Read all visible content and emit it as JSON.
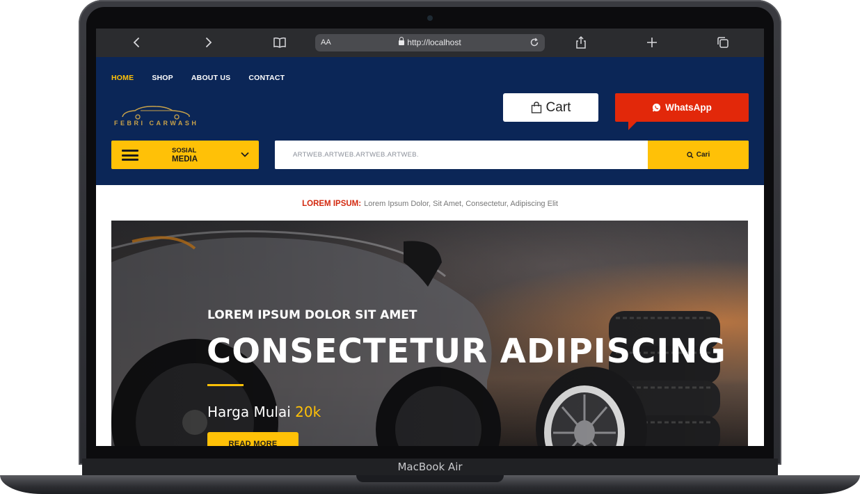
{
  "device": {
    "label": "MacBook Air"
  },
  "browser": {
    "aa_label": "AA",
    "url": "http://localhost",
    "icons": [
      "chevron-left-icon",
      "chevron-right-icon",
      "book-icon",
      "reload-icon",
      "share-icon",
      "plus-icon",
      "tabs-icon"
    ]
  },
  "nav": {
    "items": [
      {
        "label": "HOME",
        "active": true
      },
      {
        "label": "SHOP"
      },
      {
        "label": "ABOUT US"
      },
      {
        "label": "CONTACT"
      }
    ]
  },
  "logo": {
    "text": "FEBRI CARWASH"
  },
  "header": {
    "cart_label": "Cart",
    "whatsapp_label": "WhatsApp",
    "sosmed_line1": "SOSIAL",
    "sosmed_line2": "MEDIA",
    "search_placeholder": "ARTWEB.ARTWEB.ARTWEB.ARTWEB.",
    "search_button": "Cari"
  },
  "ticker": {
    "label": "LOREM IPSUM:",
    "text": "Lorem Ipsum Dolor, Sit Amet, Consectetur, Adipiscing Elit"
  },
  "hero": {
    "subtitle": "LOREM IPSUM DOLOR SIT AMET",
    "title": "CONSECTETUR ADIPISCING",
    "price_prefix": "Harga Mulai",
    "price_value": "20k",
    "button": "READ MORE"
  },
  "colors": {
    "header_bg": "#0b2657",
    "accent_yellow": "#ffc107",
    "whatsapp_red": "#e2280a",
    "ticker_red": "#d3290f"
  }
}
